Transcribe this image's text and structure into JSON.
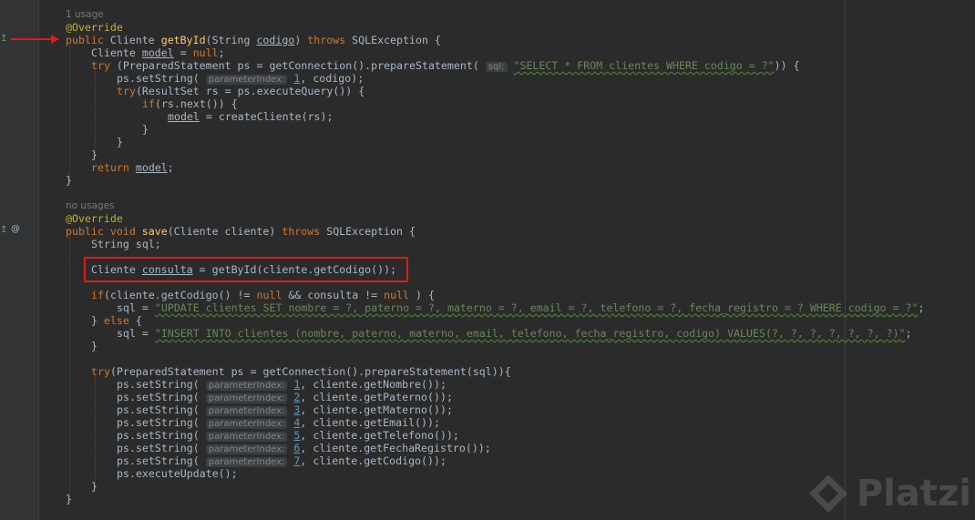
{
  "editor": {
    "usages": {
      "first": "1 usage",
      "second": "no usages"
    },
    "hints": {
      "sql": "sql:",
      "param": "parameterIndex:"
    },
    "code": {
      "l1_ann": "@Override",
      "l2": {
        "kw1": "public",
        "t1": " Cliente ",
        "fn": "getById",
        "t2": "(String ",
        "p": "codigo",
        "t3": ") ",
        "kw2": "throws",
        "t4": " SQLException {"
      },
      "l3": {
        "t1": "Cliente ",
        "v": "model",
        "t2": " = ",
        "kw": "null",
        "t3": ";"
      },
      "l4": {
        "kw": "try",
        "t1": " (PreparedStatement ps = getConnection().prepareStatement( ",
        "str": "\"SELECT * FROM clientes WHERE codigo = ?\"",
        "t2": ")) {"
      },
      "l5": {
        "t1": "ps.setString( ",
        "n": "1",
        "t2": ", codigo);"
      },
      "l6": {
        "kw": "try",
        "t1": "(ResultSet rs = ps.executeQuery()) {"
      },
      "l7": {
        "kw": "if",
        "t1": "(rs.next()) {"
      },
      "l8": {
        "v": "model",
        "t1": " = createCliente(rs);"
      },
      "close": "}",
      "l12": {
        "kw": "return",
        "t1": " ",
        "v": "model",
        "t2": ";"
      },
      "l14_ann": "@Override",
      "l15": {
        "kw1": "public",
        "t1": " ",
        "kw2": "void",
        "t2": " ",
        "fn": "save",
        "t3": "(Cliente cliente) ",
        "kw3": "throws",
        "t4": " SQLException {"
      },
      "l16": "String sql;",
      "l17": {
        "t1": "Cliente ",
        "v": "consulta",
        "t2": " = getById(cliente.getCodigo());"
      },
      "l18": {
        "kw": "if",
        "t1": "(cliente.getCodigo() != ",
        "kw2": "null",
        "t2": " && consulta != ",
        "kw3": "null",
        "t3": " ) {"
      },
      "l19": {
        "t1": "sql = ",
        "str": "\"UPDATE clientes SET nombre = ?, paterno = ?, materno = ?, email = ?, telefono = ?, fecha_registro = ? WHERE codigo = ?\"",
        "t2": ";"
      },
      "l20": {
        "t1": "} ",
        "kw": "else",
        "t2": " {"
      },
      "l21": {
        "t1": "sql = ",
        "str": "\"INSERT INTO clientes (nombre, paterno, materno, email, telefono, fecha_registro, codigo) VALUES(?, ?, ?, ?, ?, ?, ?)\"",
        "t2": ";"
      },
      "l23": {
        "kw": "try",
        "t1": "(PreparedStatement ps = getConnection().prepareStatement(sql)){"
      },
      "setters": [
        {
          "n": "1",
          "rest": ", cliente.getNombre());"
        },
        {
          "n": "2",
          "rest": ", cliente.getPaterno());"
        },
        {
          "n": "3",
          "rest": ", cliente.getMaterno());"
        },
        {
          "n": "4",
          "rest": ", cliente.getEmail());"
        },
        {
          "n": "5",
          "rest": ", cliente.getTelefono());"
        },
        {
          "n": "6",
          "rest": ", cliente.getFechaRegistro());"
        },
        {
          "n": "7",
          "rest": ", cliente.getCodigo());"
        }
      ],
      "setter_prefix": "ps.setString( ",
      "l31": "ps.executeUpdate();"
    }
  },
  "watermark": {
    "text": "Platzi"
  },
  "colors": {
    "highlight_box": "#e11a1a",
    "arrow": "#e11a1a"
  }
}
